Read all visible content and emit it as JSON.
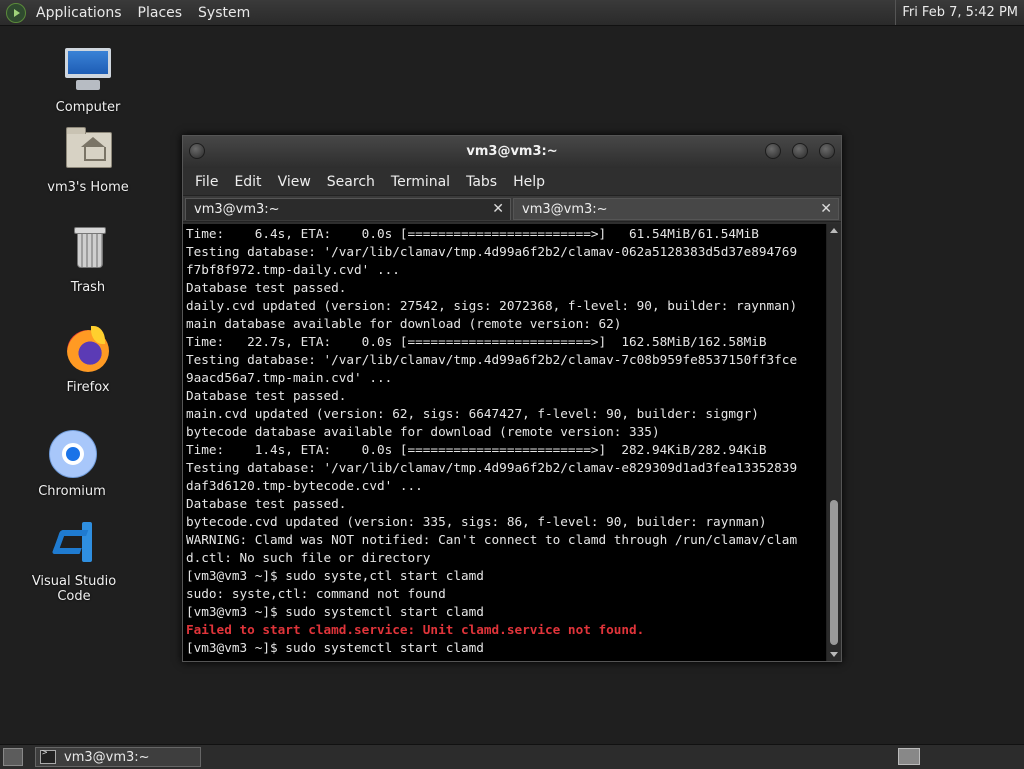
{
  "top_panel": {
    "menu": [
      "Applications",
      "Places",
      "System"
    ],
    "clock": "Fri Feb  7,  5:42 PM"
  },
  "desktop_icons": [
    {
      "label": "Computer",
      "icon": "computer-icon"
    },
    {
      "label": "vm3's Home",
      "icon": "home-folder-icon"
    },
    {
      "label": "Trash",
      "icon": "trash-icon"
    },
    {
      "label": "Firefox",
      "icon": "firefox-icon"
    },
    {
      "label": "Chromium",
      "icon": "chromium-icon"
    },
    {
      "label": "Visual Studio Code",
      "icon": "vscode-icon"
    }
  ],
  "window": {
    "title": "vm3@vm3:~",
    "menu": [
      "File",
      "Edit",
      "View",
      "Search",
      "Terminal",
      "Tabs",
      "Help"
    ],
    "tabs": [
      {
        "label": "vm3@vm3:~",
        "active": true
      },
      {
        "label": "vm3@vm3:~",
        "active": false
      }
    ],
    "close_glyph": "✕"
  },
  "terminal": {
    "lines": [
      "Time:    6.4s, ETA:    0.0s [========================>]   61.54MiB/61.54MiB",
      "Testing database: '/var/lib/clamav/tmp.4d99a6f2b2/clamav-062a5128383d5d37e894769",
      "f7bf8f972.tmp-daily.cvd' ...",
      "Database test passed.",
      "daily.cvd updated (version: 27542, sigs: 2072368, f-level: 90, builder: raynman)",
      "main database available for download (remote version: 62)",
      "Time:   22.7s, ETA:    0.0s [========================>]  162.58MiB/162.58MiB",
      "Testing database: '/var/lib/clamav/tmp.4d99a6f2b2/clamav-7c08b959fe8537150ff3fce",
      "9aacd56a7.tmp-main.cvd' ...",
      "Database test passed.",
      "main.cvd updated (version: 62, sigs: 6647427, f-level: 90, builder: sigmgr)",
      "bytecode database available for download (remote version: 335)",
      "Time:    1.4s, ETA:    0.0s [========================>]  282.94KiB/282.94KiB",
      "Testing database: '/var/lib/clamav/tmp.4d99a6f2b2/clamav-e829309d1ad3fea13352839",
      "daf3d6120.tmp-bytecode.cvd' ...",
      "Database test passed.",
      "bytecode.cvd updated (version: 335, sigs: 86, f-level: 90, builder: raynman)",
      "WARNING: Clamd was NOT notified: Can't connect to clamd through /run/clamav/clam",
      "d.ctl: No such file or directory",
      "[vm3@vm3 ~]$ sudo syste,ctl start clamd",
      "sudo: syste,ctl: command not found",
      "[vm3@vm3 ~]$ sudo systemctl start clamd",
      "Failed to start clamd.service: Unit clamd.service not found.",
      "[vm3@vm3 ~]$ sudo systemctl start clamd"
    ],
    "error_color": "#e0343a",
    "error_line_index": 22
  },
  "bottom_panel": {
    "task_label": "vm3@vm3:~"
  }
}
